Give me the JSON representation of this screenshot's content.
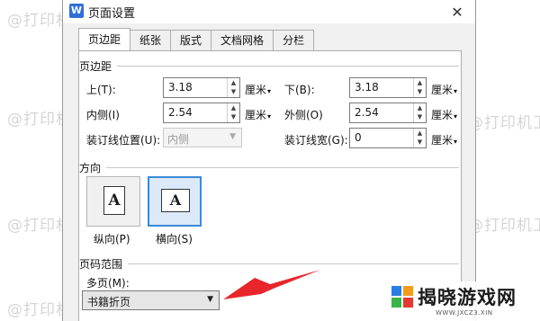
{
  "window": {
    "icon_letter": "W",
    "title": "页面设置",
    "close_symbol": "✕"
  },
  "tabs": [
    {
      "label": "页边距",
      "active": true
    },
    {
      "label": "纸张"
    },
    {
      "label": "版式"
    },
    {
      "label": "文档网格"
    },
    {
      "label": "分栏"
    }
  ],
  "margins": {
    "title": "页边距",
    "top": {
      "label": "上(T):",
      "value": "3.18",
      "unit": "厘米"
    },
    "bottom": {
      "label": "下(B):",
      "value": "3.18",
      "unit": "厘米"
    },
    "inner": {
      "label": "内侧(I)",
      "value": "2.54",
      "unit": "厘米"
    },
    "outer": {
      "label": "外侧(O)",
      "value": "2.54",
      "unit": "厘米"
    },
    "gutter_pos": {
      "label": "装订线位置(U):",
      "value": "内侧"
    },
    "gutter_width": {
      "label": "装订线宽(G):",
      "value": "0",
      "unit": "厘米"
    }
  },
  "orientation": {
    "title": "方向",
    "portrait": {
      "label": "纵向(P)",
      "glyph": "A"
    },
    "landscape": {
      "label": "横向(S)",
      "glyph": "A",
      "selected": true
    }
  },
  "pages": {
    "title": "页码范围",
    "multiple_label": "多页(M):",
    "multiple_value": "书籍折页"
  },
  "watermark_text": "@打印机卫士",
  "site_logo": {
    "name": "揭晓游戏网",
    "url": "WWW.JXCZ3.XIN"
  },
  "colors": {
    "arrow": "#e8262b",
    "accent": "#3c8ad8"
  }
}
